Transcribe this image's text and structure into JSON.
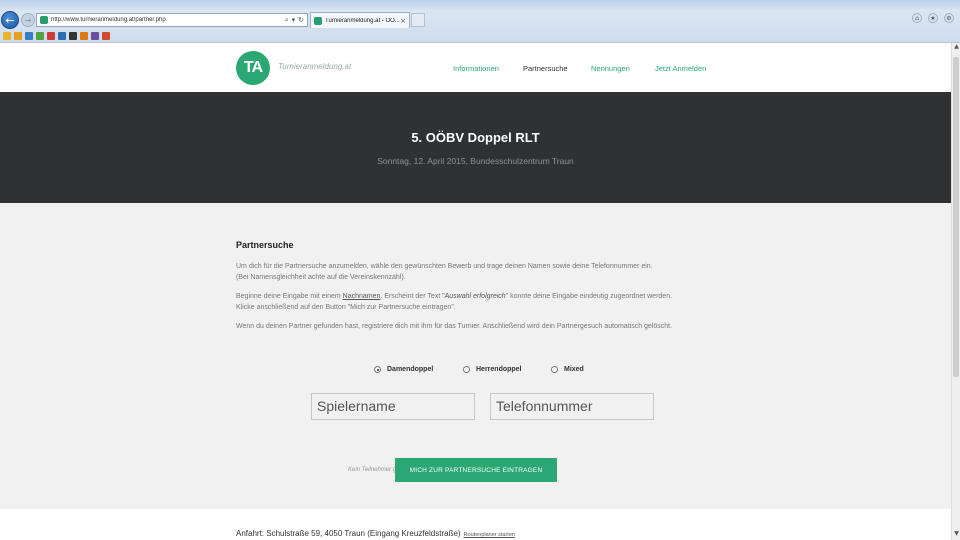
{
  "browser": {
    "url": "http://www.turnieranmeldung.at/partner.php",
    "tab_title": "Turnieranmeldung.at - OÖ...",
    "tab_close": "×",
    "back_glyph": "←",
    "forward_glyph": "→",
    "address_controls": [
      "⌕",
      "▾",
      "↻"
    ],
    "window_icons": [
      "⌂",
      "★",
      "⚙"
    ],
    "favorites_bar_colors": [
      "#e8b52b",
      "#e4a020",
      "#3a7bc8",
      "#55a040",
      "#cf3a3a",
      "#2c6fb0",
      "#333333",
      "#e07a10",
      "#6a4fa0",
      "#d24b2a"
    ]
  },
  "site": {
    "logo_text": "TA",
    "brand": "Turnieranmeldung.at",
    "accent_color": "#2aa772",
    "nav": [
      {
        "label": "Informationen",
        "active": false
      },
      {
        "label": "Partnersuche",
        "active": true
      },
      {
        "label": "Nennungen",
        "active": false
      },
      {
        "label": "Jetzt Anmelden",
        "active": false
      }
    ]
  },
  "hero": {
    "title": "5. OÖBV Doppel RLT",
    "subtitle": "Sonntag, 12. April 2015, Bundesschulzentrum Traun"
  },
  "partner_search": {
    "heading": "Partnersuche",
    "para1_line1": "Um dich für die Partnersuche anzumelden, wähle den gewünschten Bewerb und trage deinen Namen sowie deine Telefonnummer ein.",
    "para1_line2": "(Bei Namensgleichheit achte auf die Vereinskennzahl).",
    "para2_a": "Beginne deine Eingabe mit einem ",
    "para2_u": "Nachnamen",
    "para2_b": ". Erscheint der Text \"",
    "para2_i": "Auswahl erfolgreich",
    "para2_c": "\" konnte deine Eingabe eindeutig zugeordnet werden.",
    "para2_line2": "Klicke anschließend auf den Button \"Mich zur Partnersuche eintragen\".",
    "para3": "Wenn du deinen Partner gefunden hast, registriere dich mit ihm für das Turnier. Anschließend wird dein Partnergesuch automatisch gelöscht.",
    "options": [
      {
        "label": "Damendoppel",
        "checked": true
      },
      {
        "label": "Herrendoppel",
        "checked": false
      },
      {
        "label": "Mixed",
        "checked": false
      }
    ],
    "player_placeholder": "Spielername",
    "phone_placeholder": "Telefonnummer",
    "player_hint": "Kein Teilnehmer gewählt",
    "submit_label": "MICH ZUR PARTNERSUCHE EINTRAGEN"
  },
  "footer": {
    "directions": "Anfahrt: Schulstraße 59, 4050 Traun (Eingang Kreuzfeldstraße)",
    "route_link": "Routenplaner starten"
  },
  "scrollbar": {
    "up": "▲",
    "down": "▼"
  }
}
